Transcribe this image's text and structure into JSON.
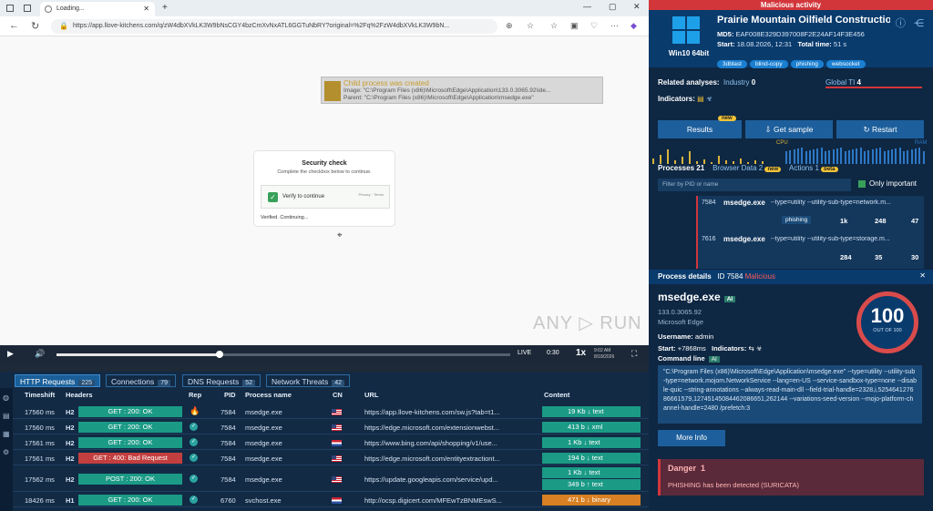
{
  "browser": {
    "tab_title": "Loading...",
    "url": "https://app.llove-kitchens.com/q/zW4dbXVkLK3W9bNsCGY4bzCmXvNxATL6GGTuNbRY?original=%2Fq%2FzW4dbXVkLK3W9bN..."
  },
  "notification": {
    "title": "Child process was created",
    "image": "Image: \"C:\\Program Files (x86)\\Microsoft\\Edge\\Application\\133.0.3065.92\\ide...",
    "parent": "Parent: \"C:\\Program Files (x86)\\Microsoft\\Edge\\Application\\msedge.exe\""
  },
  "captcha": {
    "title": "Security check",
    "subtitle": "Complete the checkbox below to continue.",
    "verify_label": "Verify to continue",
    "privacy": "Privacy · Terms",
    "status": "Verified. Continuing..."
  },
  "watermark": "ANY ▷ RUN",
  "player": {
    "live": "LIVE",
    "time": "0:30",
    "speed": "1x",
    "progress": 0.36,
    "clock": "9:02 AM",
    "date": "8/18/2026"
  },
  "tabs": [
    {
      "label": "HTTP Requests",
      "count": "225"
    },
    {
      "label": "Connections",
      "count": "79"
    },
    {
      "label": "DNS Requests",
      "count": "52"
    },
    {
      "label": "Network Threats",
      "count": "42"
    }
  ],
  "table": {
    "headers": [
      "Timeshift",
      "Headers",
      "Rep",
      "PID",
      "Process name",
      "CN",
      "URL",
      "Content"
    ],
    "rows": [
      {
        "time": "17560 ms",
        "ver": "H2",
        "req": "GET : 200: OK",
        "pid": "7584",
        "proc": "msedge.exe",
        "url": "https://app.llove-kitchens.com/sw.js?tab=t1...",
        "size": "19 Kb",
        "type": "text"
      },
      {
        "time": "17560 ms",
        "ver": "H2",
        "req": "GET : 200: OK",
        "pid": "7584",
        "proc": "msedge.exe",
        "url": "https://edge.microsoft.com/extensionwebst...",
        "size": "413 b",
        "type": "xml"
      },
      {
        "time": "17561 ms",
        "ver": "H2",
        "req": "GET : 200: OK",
        "pid": "7584",
        "proc": "msedge.exe",
        "url": "https://www.bing.com/api/shopping/v1/use...",
        "size": "1 Kb",
        "type": "text"
      },
      {
        "time": "17561 ms",
        "ver": "H2",
        "req": "GET : 400: Bad Request",
        "pid": "7584",
        "proc": "msedge.exe",
        "url": "https://edge.microsoft.com/entityextractiont...",
        "size": "194 b",
        "type": "text"
      },
      {
        "time": "17562 ms",
        "ver": "H2",
        "req": "POST : 200: OK",
        "pid": "7584",
        "proc": "msedge.exe",
        "url": "https://update.googleapis.com/service/upd...",
        "size": "1 Kb",
        "type": "text",
        "size2": "349 b",
        "type2": "text"
      },
      {
        "time": "18426 ms",
        "ver": "H1",
        "req": "GET : 200: OK",
        "pid": "6760",
        "proc": "svchost.exe",
        "url": "http://ocsp.digicert.com/MFEwTzBNMEswS...",
        "size": "471 b",
        "type": "binary"
      }
    ]
  },
  "report": {
    "malicious": "Malicious activity",
    "title": "Prairie Mountain Oilfield Construction I...",
    "os": "Win10 64bit",
    "md5_label": "MD5:",
    "md5": "EAF008E329D397008F2E24AF14F3E456",
    "start_label": "Start:",
    "start": "18.08.2026, 12:31",
    "total_label": "Total time:",
    "total": "51 s",
    "tags": [
      "3dblast",
      "blind-copy",
      "phishing",
      "websocket"
    ],
    "related_label": "Related analyses:",
    "industry_label": "Industry",
    "industry": "0",
    "global_label": "Global TI",
    "global": "4",
    "indicators_label": "Indicators:",
    "results": "Results",
    "new": "new",
    "get_sample": "Get sample",
    "restart": "Restart",
    "cpu": "CPU",
    "ram": "RAM",
    "processes_label": "Processes",
    "processes": "21",
    "browser_data_label": "Browser Data",
    "browser_data": "2",
    "actions_label": "Actions",
    "actions": "1",
    "beta": "beta",
    "filter_placeholder": "Filter by PID or name",
    "only_important": "Only important",
    "procs": [
      {
        "pid": "7584",
        "name": "msedge.exe",
        "args": "--type=utility --utility-sub-type=network.m...",
        "tag": "phishing",
        "s1": "1k",
        "s2": "248",
        "s3": "47"
      },
      {
        "pid": "7616",
        "name": "msedge.exe",
        "args": "--type=utility --utility-sub-type=storage.m...",
        "s1": "284",
        "s2": "35",
        "s3": "30"
      }
    ],
    "detail_label": "Process details",
    "detail_id": "ID 7584",
    "detail_status": "Malicious",
    "detail_name": "msedge.exe",
    "ai": "AI",
    "version": "133.0.3065.92",
    "company": "Microsoft Edge",
    "username_label": "Username:",
    "username": "admin",
    "pstart_label": "Start:",
    "pstart": "+7868ms",
    "pindicators_label": "Indicators:",
    "cmd_label": "Command line",
    "cmd": "\"C:\\Program Files (x86)\\Microsoft\\Edge\\Application\\msedge.exe\" --type=utility --utility-sub-type=network.mojom.NetworkService --lang=en-US --service-sandbox-type=none --disable-quic --string-annotations --always-read-main-dll --field-trial-handle=2328,i,525464127686661579,12745145084462086651,262144 --variations-seed-version --mojo-platform-channel-handle=2480 /prefetch:3",
    "score": "100",
    "score_out": "OUT OF 100",
    "more_info": "More Info",
    "danger_label": "Danger",
    "danger_count": "1",
    "danger_text": "PHISHING has been detected (SURICATA)"
  },
  "colors": {
    "malicious": "#d2363b",
    "accent": "#1b9a86",
    "header": "#0a3b6d"
  }
}
